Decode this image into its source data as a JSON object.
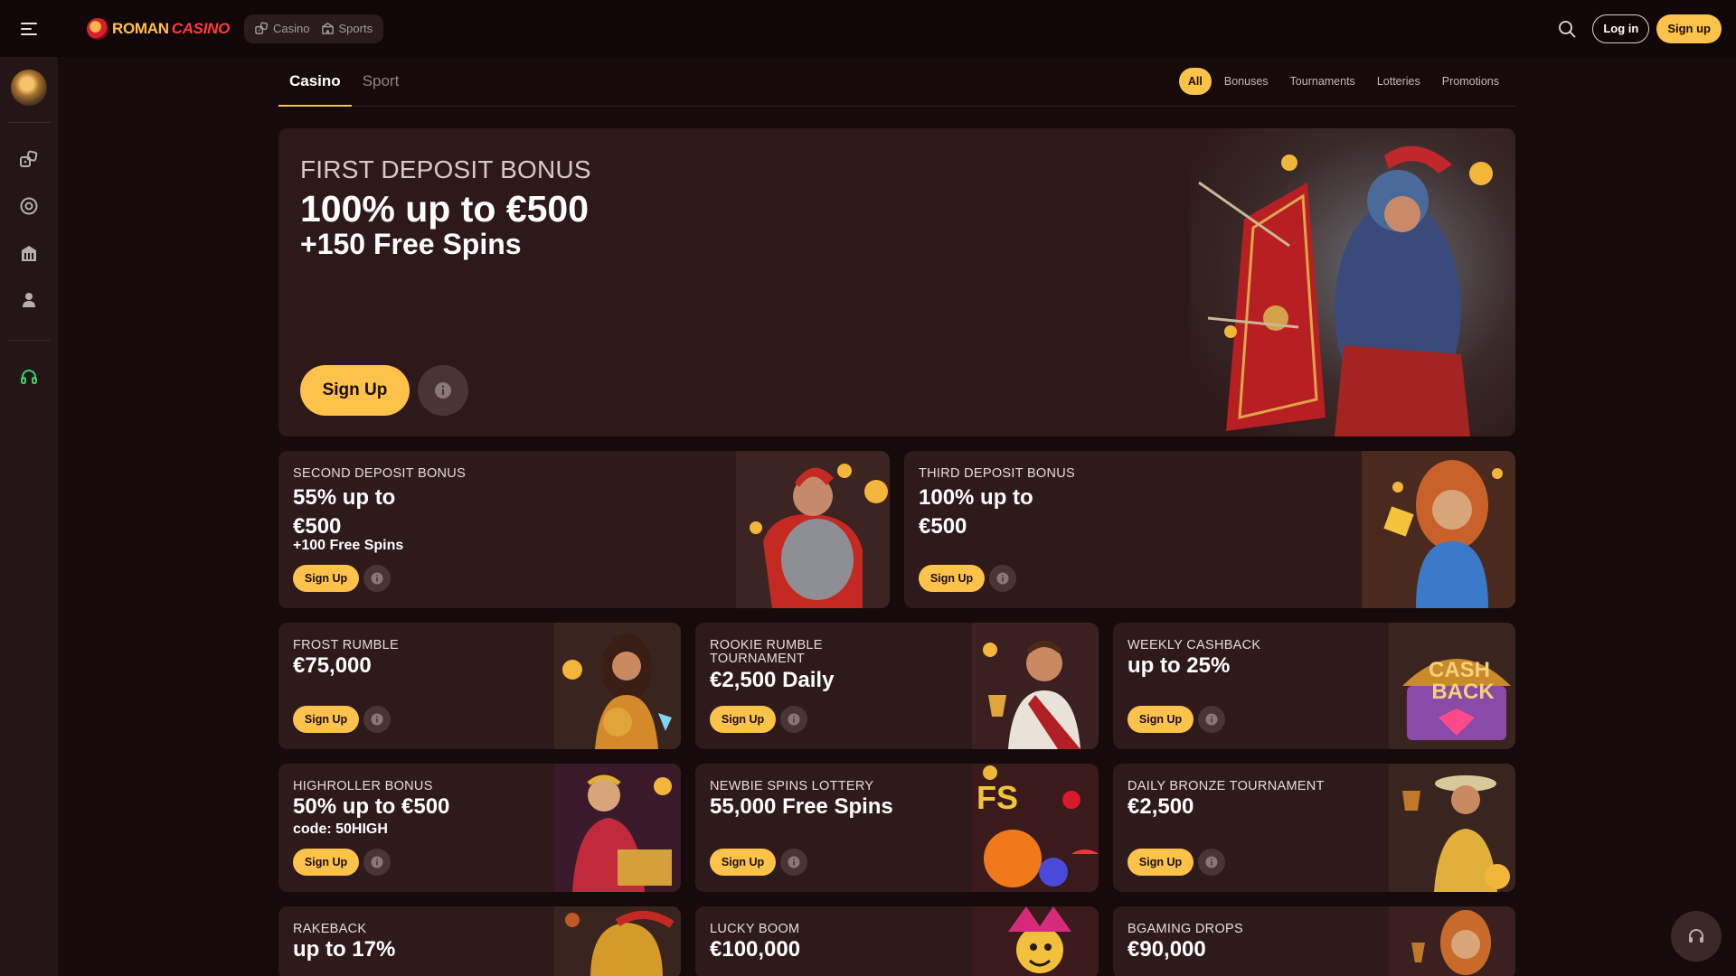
{
  "brand": {
    "name_part1": "ROMAN",
    "name_part2": "CASINO"
  },
  "header": {
    "segments": [
      {
        "label": "Casino",
        "icon": "dice-icon"
      },
      {
        "label": "Sports",
        "icon": "stadium-icon"
      }
    ],
    "login_label": "Log in",
    "signup_label": "Sign up",
    "search_icon": "search-icon",
    "menu_icon": "hamburger-menu-icon"
  },
  "sidebar": {
    "items": [
      {
        "name": "casino",
        "icon": "dice-icon"
      },
      {
        "name": "sports",
        "icon": "football-icon"
      },
      {
        "name": "live-casino",
        "icon": "building-icon"
      },
      {
        "name": "profile",
        "icon": "user-icon"
      },
      {
        "name": "support",
        "icon": "headphones-icon"
      }
    ]
  },
  "tabs": {
    "casino": "Casino",
    "sport": "Sport"
  },
  "filters": {
    "all": "All",
    "bonuses": "Bonuses",
    "tournaments": "Tournaments",
    "lotteries": "Lotteries",
    "promotions": "Promotions"
  },
  "hero": {
    "kicker": "FIRST DEPOSIT BONUS",
    "line1": "100% up to €500",
    "line2": "+150 Free Spins",
    "button": "Sign Up"
  },
  "promos": [
    {
      "title": "SECOND DEPOSIT BONUS",
      "value_line1": "55% up to",
      "value_line2": "€500",
      "sub": "+100 Free Spins",
      "button": "Sign Up"
    },
    {
      "title": "THIRD DEPOSIT BONUS",
      "value_line1": "100% up to",
      "value_line2": "€500",
      "button": "Sign Up"
    },
    {
      "title": "FROST RUMBLE",
      "value": "€75,000",
      "button": "Sign Up"
    },
    {
      "title_line1": "ROOKIE RUMBLE",
      "title_line2": "TOURNAMENT",
      "value": "€2,500 Daily",
      "button": "Sign Up"
    },
    {
      "title": "WEEKLY CASHBACK",
      "value": "up to 25%",
      "button": "Sign Up",
      "art_text_1": "CASH",
      "art_text_2": "BACK"
    },
    {
      "title": "HIGHROLLER BONUS",
      "value": "50% up to €500",
      "sub": "code: 50HIGH",
      "button": "Sign Up"
    },
    {
      "title": "NEWBIE SPINS LOTTERY",
      "value": "55,000 Free Spins",
      "button": "Sign Up",
      "art_text": "FS"
    },
    {
      "title": "DAILY BRONZE TOURNAMENT",
      "value": "€2,500",
      "button": "Sign Up"
    },
    {
      "title": "RAKEBACK",
      "value": "up to 17%"
    },
    {
      "title": "LUCKY BOOM",
      "value": "€100,000"
    },
    {
      "title": "BGAMING DROPS",
      "value": "€90,000"
    }
  ],
  "colors": {
    "accent": "#fcc24a",
    "background": "#160a0b",
    "card": "#2f1a1b",
    "sidebar": "#241617",
    "support_green": "#3bd16f"
  }
}
